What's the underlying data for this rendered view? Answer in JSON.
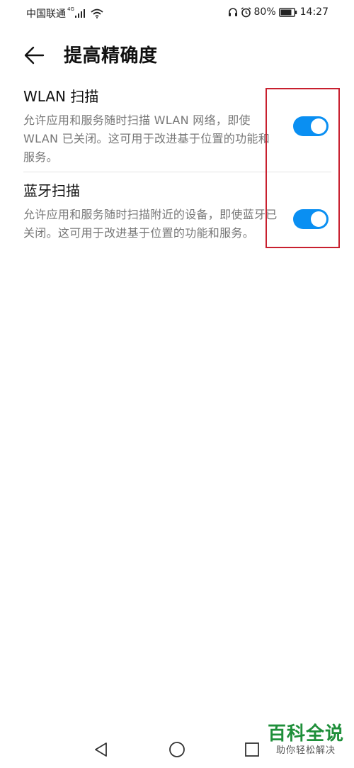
{
  "status_bar": {
    "carrier": "中国联通",
    "network_type": "4G",
    "battery_percent": "80%",
    "time": "14:27"
  },
  "header": {
    "title": "提高精确度"
  },
  "settings": [
    {
      "title": "WLAN 扫描",
      "description": "允许应用和服务随时扫描 WLAN 网络，即使 WLAN 已关闭。这可用于改进基于位置的功能和服务。",
      "enabled": true
    },
    {
      "title": "蓝牙扫描",
      "description": "允许应用和服务随时扫描附近的设备，即使蓝牙已关闭。这可用于改进基于位置的功能和服务。",
      "enabled": true
    }
  ],
  "watermark": {
    "brand": "百科全说",
    "slogan": "助你轻松解决"
  },
  "colors": {
    "toggle_on": "#0a8ff2",
    "highlight": "#c8202f",
    "watermark_green": "#1f8f3a"
  }
}
